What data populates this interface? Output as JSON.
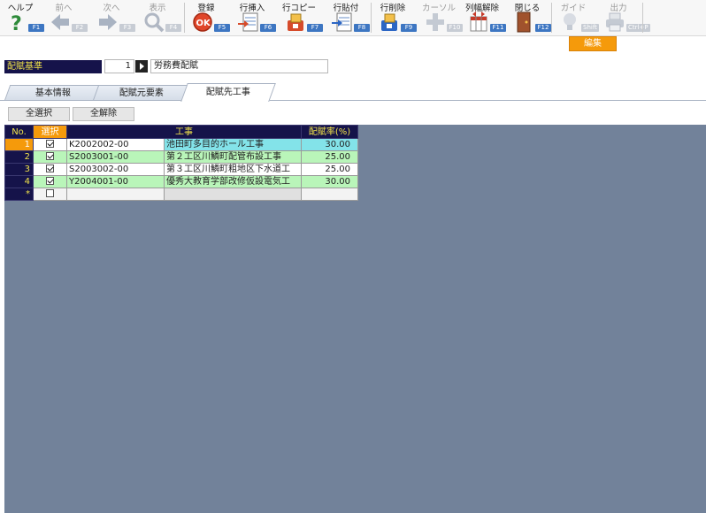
{
  "toolbar": {
    "buttons": [
      {
        "label": "ヘルプ",
        "key": "F1",
        "icon": "help-icon"
      },
      {
        "label": "前へ",
        "key": "F2",
        "icon": "arrow-left-icon"
      },
      {
        "label": "次へ",
        "key": "F3",
        "icon": "arrow-right-icon"
      },
      {
        "label": "表示",
        "key": "F4",
        "icon": "magnifier-icon"
      },
      {
        "label": "登録",
        "key": "F5",
        "icon": "ok-icon"
      },
      {
        "label": "行挿入",
        "key": "F6",
        "icon": "row-insert-icon"
      },
      {
        "label": "行コピー",
        "key": "F7",
        "icon": "row-copy-icon"
      },
      {
        "label": "行貼付",
        "key": "F8",
        "icon": "row-paste-icon"
      },
      {
        "label": "行削除",
        "key": "F9",
        "icon": "row-delete-icon"
      },
      {
        "label": "カーソル",
        "key": "F10",
        "icon": "cursor-icon"
      },
      {
        "label": "列幅解除",
        "key": "F11",
        "icon": "column-width-icon"
      },
      {
        "label": "閉じる",
        "key": "F12",
        "icon": "door-icon"
      },
      {
        "label": "ガイド",
        "key": "Shift",
        "icon": "bulb-icon"
      },
      {
        "label": "出力",
        "key": "Ctrl+P",
        "icon": "printer-icon"
      }
    ],
    "mode_badge": "編集"
  },
  "criteria": {
    "label": "配賦基準",
    "number": "1",
    "name": "労務費配賦"
  },
  "tabs": [
    "基本情報",
    "配賦元要素",
    "配賦先工事"
  ],
  "actions": {
    "select_all": "全選択",
    "deselect_all": "全解除"
  },
  "grid": {
    "headers": {
      "no": "No.",
      "select": "選択",
      "project": "工事",
      "rate": "配賦率(%)"
    },
    "rows": [
      {
        "no": "1",
        "checked": true,
        "code": "K2002002-00",
        "name": "池田町多目的ホール工事",
        "rate": "30.00"
      },
      {
        "no": "2",
        "checked": true,
        "code": "S2003001-00",
        "name": "第２工区川鱗町配管布設工事",
        "rate": "25.00"
      },
      {
        "no": "3",
        "checked": true,
        "code": "S2003002-00",
        "name": "第３工区川鱗町粗地区下水道工",
        "rate": "25.00"
      },
      {
        "no": "4",
        "checked": true,
        "code": "Y2004001-00",
        "name": "優秀大教育学部改修仮設電気工",
        "rate": "30.00"
      }
    ],
    "new_row_marker": "*"
  },
  "colors": {
    "header_bg": "#15134a",
    "header_text": "#f0e24a",
    "accent_orange": "#f59a0b",
    "selected_row": "#83e3e9",
    "alt_row": "#b9f5b9",
    "grid_background": "#72829a"
  }
}
